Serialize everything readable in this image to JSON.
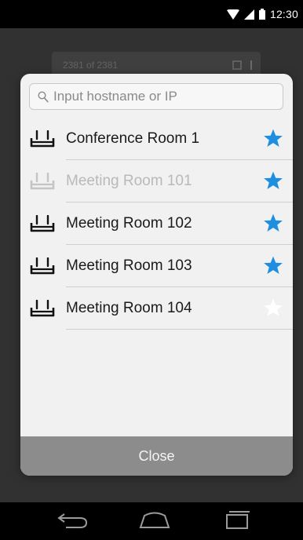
{
  "status_bar": {
    "time": "12:30",
    "icons": [
      "wifi-icon",
      "signal-icon",
      "battery-icon"
    ]
  },
  "background": {
    "count_text": "2381 of 2381",
    "icons": [
      "copy-icon",
      "overflow-menu-icon"
    ]
  },
  "dialog": {
    "search": {
      "placeholder": "Input hostname or IP",
      "value": "",
      "icon": "search-icon"
    },
    "items": [
      {
        "label": "Conference Room 1",
        "enabled": true,
        "favorite": true,
        "icon": "router-icon"
      },
      {
        "label": "Meeting Room 101",
        "enabled": false,
        "favorite": true,
        "icon": "router-icon"
      },
      {
        "label": "Meeting Room 102",
        "enabled": true,
        "favorite": true,
        "icon": "router-icon"
      },
      {
        "label": "Meeting Room 103",
        "enabled": true,
        "favorite": true,
        "icon": "router-icon"
      },
      {
        "label": "Meeting Room 104",
        "enabled": true,
        "favorite": false,
        "icon": "router-icon"
      }
    ],
    "close_label": "Close"
  },
  "nav_bar": {
    "icons": [
      "back-icon",
      "home-icon",
      "recents-icon"
    ]
  },
  "colors": {
    "accent_star": "#1e8fe0",
    "star_off": "#ffffff",
    "dialog_bg": "#f1f1f1",
    "close_bar": "#8c8c8c",
    "disabled_text": "#b9b9b9"
  }
}
